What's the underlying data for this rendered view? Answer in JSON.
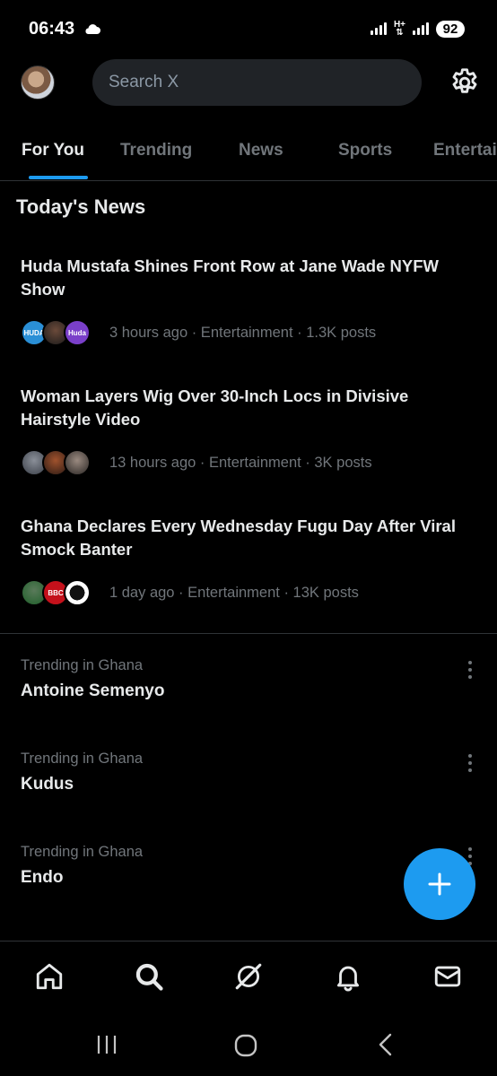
{
  "status_bar": {
    "time": "06:43",
    "network": "H+",
    "battery": "92"
  },
  "header": {
    "search_placeholder": "Search X"
  },
  "tabs": [
    {
      "label": "For You",
      "active": true
    },
    {
      "label": "Trending",
      "active": false
    },
    {
      "label": "News",
      "active": false
    },
    {
      "label": "Sports",
      "active": false
    },
    {
      "label": "Entertai",
      "active": false
    }
  ],
  "section": {
    "title": "Today's News"
  },
  "news": [
    {
      "headline": "Huda Mustafa Shines Front Row at Jane Wade NYFW Show",
      "meta": "3 hours ago · Entertainment · 1.3K posts",
      "avatar_labels": [
        "HUDA",
        "",
        "Huda"
      ]
    },
    {
      "headline": "Woman Layers Wig Over 30-Inch Locs in Divisive Hairstyle Video",
      "meta": "13 hours ago · Entertainment · 3K posts",
      "avatar_labels": [
        "",
        "",
        ""
      ]
    },
    {
      "headline": "Ghana Declares Every Wednesday Fugu Day After Viral Smock Banter",
      "meta": "1 day ago · Entertainment · 13K posts",
      "avatar_labels": [
        "",
        "BBC",
        ""
      ]
    }
  ],
  "trends": [
    {
      "context": "Trending in Ghana",
      "name": "Antoine Semenyo"
    },
    {
      "context": "Trending in Ghana",
      "name": "Kudus"
    },
    {
      "context": "Trending in Ghana",
      "name": "Endo"
    }
  ],
  "colors": {
    "accent": "#1d9bf0",
    "background": "#000000",
    "muted_text": "#71767b",
    "search_bg": "#202327"
  },
  "bottom_nav": [
    "home-icon",
    "search-icon",
    "grok-icon",
    "notifications-icon",
    "messages-icon"
  ]
}
